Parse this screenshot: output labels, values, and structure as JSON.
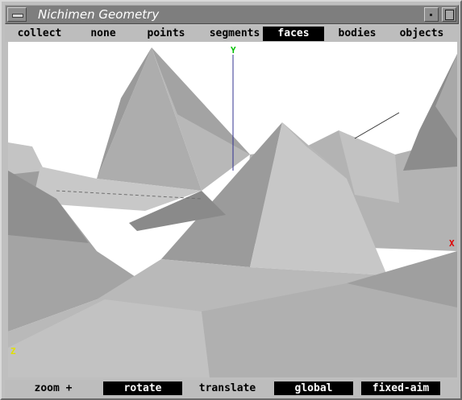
{
  "window": {
    "title": "Nichimen Geometry"
  },
  "menubar": {
    "items": [
      {
        "label": "collect",
        "active": false
      },
      {
        "label": "none",
        "active": false
      },
      {
        "label": "points",
        "active": false
      },
      {
        "label": "segments",
        "active": false
      },
      {
        "label": "faces",
        "active": true
      },
      {
        "label": "bodies",
        "active": false
      },
      {
        "label": "objects",
        "active": false
      }
    ]
  },
  "viewport": {
    "axis_labels": {
      "y": "Y",
      "x": "X",
      "z": "Z"
    },
    "colors": {
      "y": "#00c000",
      "x": "#e00000",
      "z": "#e0e000",
      "axis_line": "#303090"
    }
  },
  "toolbar": {
    "items": [
      {
        "label": "zoom +",
        "style": "light"
      },
      {
        "label": "rotate",
        "style": "dark"
      },
      {
        "label": "translate",
        "style": "light"
      },
      {
        "label": "global",
        "style": "dark"
      },
      {
        "label": "fixed-aim",
        "style": "dark"
      }
    ]
  }
}
